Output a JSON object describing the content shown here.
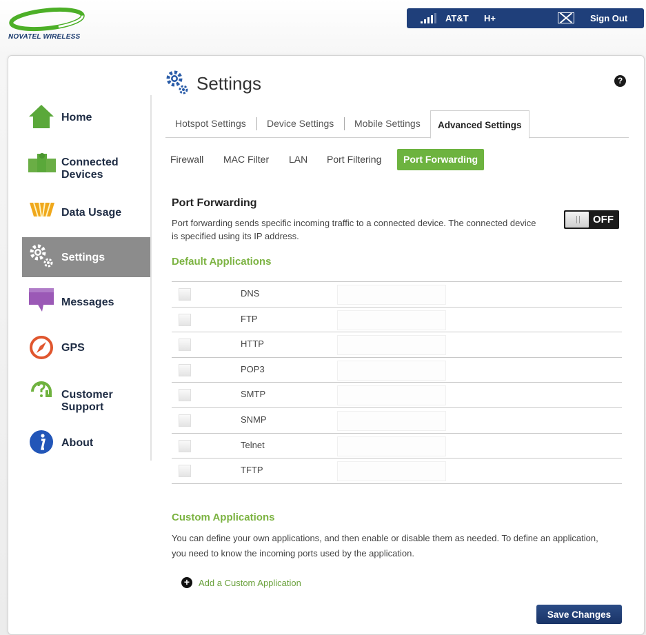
{
  "brand": {
    "logo_text": "NOVATEL WIRELESS"
  },
  "header": {
    "carrier": "AT&T",
    "network": "H+",
    "signout_label": "Sign Out"
  },
  "sidebar": {
    "items": [
      {
        "label_line1": "Home",
        "label_line2": "",
        "icon": "home-icon",
        "active": false
      },
      {
        "label_line1": "Connected",
        "label_line2": "Devices",
        "icon": "connected-devices-icon",
        "active": false
      },
      {
        "label_line1": "Data Usage",
        "label_line2": "",
        "icon": "data-usage-icon",
        "active": false
      },
      {
        "label_line1": "Settings",
        "label_line2": "",
        "icon": "gear-icon",
        "active": true
      },
      {
        "label_line1": "Messages",
        "label_line2": "",
        "icon": "message-icon",
        "active": false
      },
      {
        "label_line1": "GPS",
        "label_line2": "",
        "icon": "compass-icon",
        "active": false
      },
      {
        "label_line1": "Customer",
        "label_line2": "Support",
        "icon": "support-icon",
        "active": false
      },
      {
        "label_line1": "About",
        "label_line2": "",
        "icon": "info-icon",
        "active": false
      }
    ]
  },
  "page": {
    "title": "Settings"
  },
  "tabs": [
    {
      "label": "Hotspot Settings",
      "active": false
    },
    {
      "label": "Device Settings",
      "active": false
    },
    {
      "label": "Mobile Settings",
      "active": false
    },
    {
      "label": "Advanced Settings",
      "active": true
    }
  ],
  "subtabs": [
    {
      "label": "Firewall",
      "active": false
    },
    {
      "label": "MAC Filter",
      "active": false
    },
    {
      "label": "LAN",
      "active": false
    },
    {
      "label": "Port Filtering",
      "active": false
    },
    {
      "label": "Port Forwarding",
      "active": true
    }
  ],
  "port_forwarding": {
    "title": "Port Forwarding",
    "description": "Port forwarding sends specific incoming traffic to a connected device. The connected device is specified using its IP address.",
    "toggle_state": "OFF"
  },
  "default_apps": {
    "heading": "Default Applications",
    "items": [
      {
        "name": "DNS",
        "checked": false,
        "value": ""
      },
      {
        "name": "FTP",
        "checked": false,
        "value": ""
      },
      {
        "name": "HTTP",
        "checked": false,
        "value": ""
      },
      {
        "name": "POP3",
        "checked": false,
        "value": ""
      },
      {
        "name": "SMTP",
        "checked": false,
        "value": ""
      },
      {
        "name": "SNMP",
        "checked": false,
        "value": ""
      },
      {
        "name": "Telnet",
        "checked": false,
        "value": ""
      },
      {
        "name": "TFTP",
        "checked": false,
        "value": ""
      }
    ]
  },
  "custom_apps": {
    "heading": "Custom Applications",
    "description": "You can define your own applications, and then enable or disable them as needed. To define an application, you need to know the incoming ports used by the application.",
    "add_label": "Add a Custom Application"
  },
  "actions": {
    "save_label": "Save Changes"
  },
  "colors": {
    "brand_navy": "#1f3f7a",
    "accent_green": "#6db33f",
    "heading_green": "#7cb342",
    "active_nav": "#8c8c8c"
  }
}
